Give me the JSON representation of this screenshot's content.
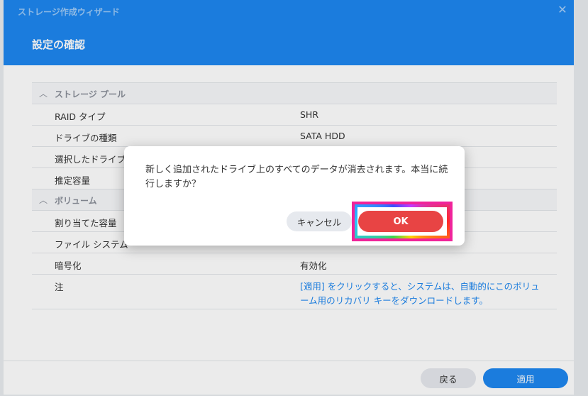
{
  "window": {
    "wizard_title": "ストレージ作成ウィザード",
    "close_symbol": "✕",
    "page_title": "設定の確認"
  },
  "sections": {
    "storage_pool": {
      "label": "ストレージ プール",
      "rows": [
        {
          "label": "RAID タイプ",
          "value": "SHR"
        },
        {
          "label": "ドライブの種類",
          "value": "SATA HDD"
        },
        {
          "label": "選択したドライブ",
          "value": ""
        },
        {
          "label": "推定容量",
          "value": ""
        }
      ]
    },
    "volume": {
      "label": "ボリューム",
      "rows": [
        {
          "label": "割り当てた容量",
          "value": ""
        },
        {
          "label": "ファイル システム",
          "value": ""
        },
        {
          "label": "暗号化",
          "value": "有効化"
        }
      ],
      "note_label": "注",
      "note_value": "[適用] をクリックすると、システムは、自動的にこのボリューム用のリカバリ キーをダウンロードします。"
    }
  },
  "footer": {
    "back_label": "戻る",
    "apply_label": "適用"
  },
  "dialog": {
    "message": "新しく追加されたドライブ上のすべてのデータが消去されます。本当に続行しますか？",
    "cancel_label": "キャンセル",
    "ok_label": "OK"
  },
  "colors": {
    "accent": "#1e87f0",
    "ok_button": "#e84444",
    "highlight_border": "#f0239a"
  },
  "icons": {
    "close": "close-icon",
    "collapse": "chevron-up-icon"
  }
}
